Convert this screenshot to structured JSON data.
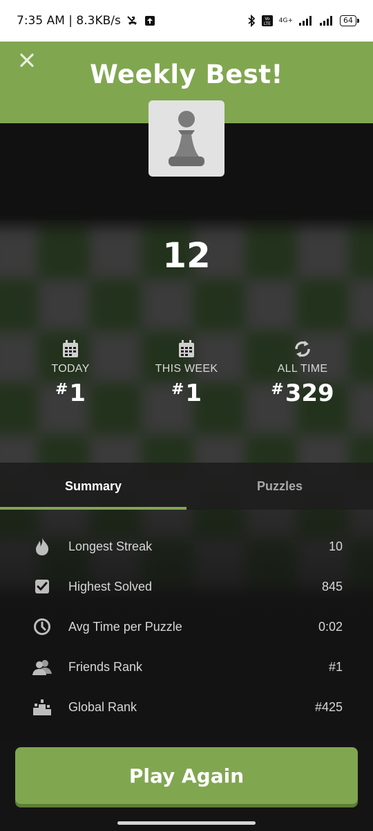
{
  "status_bar": {
    "time_speed": "7:35 AM | 8.3KB/s",
    "network": "4G+",
    "volte": "Vo LTE",
    "battery": "64"
  },
  "header": {
    "title": "Weekly Best!",
    "close_icon": "close-icon",
    "accent_color": "#81a650"
  },
  "score": "12",
  "stats": [
    {
      "label": "TODAY",
      "value": "1",
      "icon": "calendar-icon"
    },
    {
      "label": "THIS WEEK",
      "value": "1",
      "icon": "calendar-icon"
    },
    {
      "label": "ALL TIME",
      "value": "329",
      "icon": "refresh-icon"
    }
  ],
  "tabs": [
    {
      "label": "Summary",
      "active": true
    },
    {
      "label": "Puzzles",
      "active": false
    }
  ],
  "summary": [
    {
      "label": "Longest Streak",
      "value": "10",
      "icon": "flame-icon"
    },
    {
      "label": "Highest Solved",
      "value": "845",
      "icon": "checkbox-icon"
    },
    {
      "label": "Avg Time per Puzzle",
      "value": "0:02",
      "icon": "clock-icon"
    },
    {
      "label": "Friends Rank",
      "value": "#1",
      "icon": "friends-icon"
    },
    {
      "label": "Global Rank",
      "value": "#425",
      "icon": "podium-icon"
    }
  ],
  "play_button": "Play Again"
}
